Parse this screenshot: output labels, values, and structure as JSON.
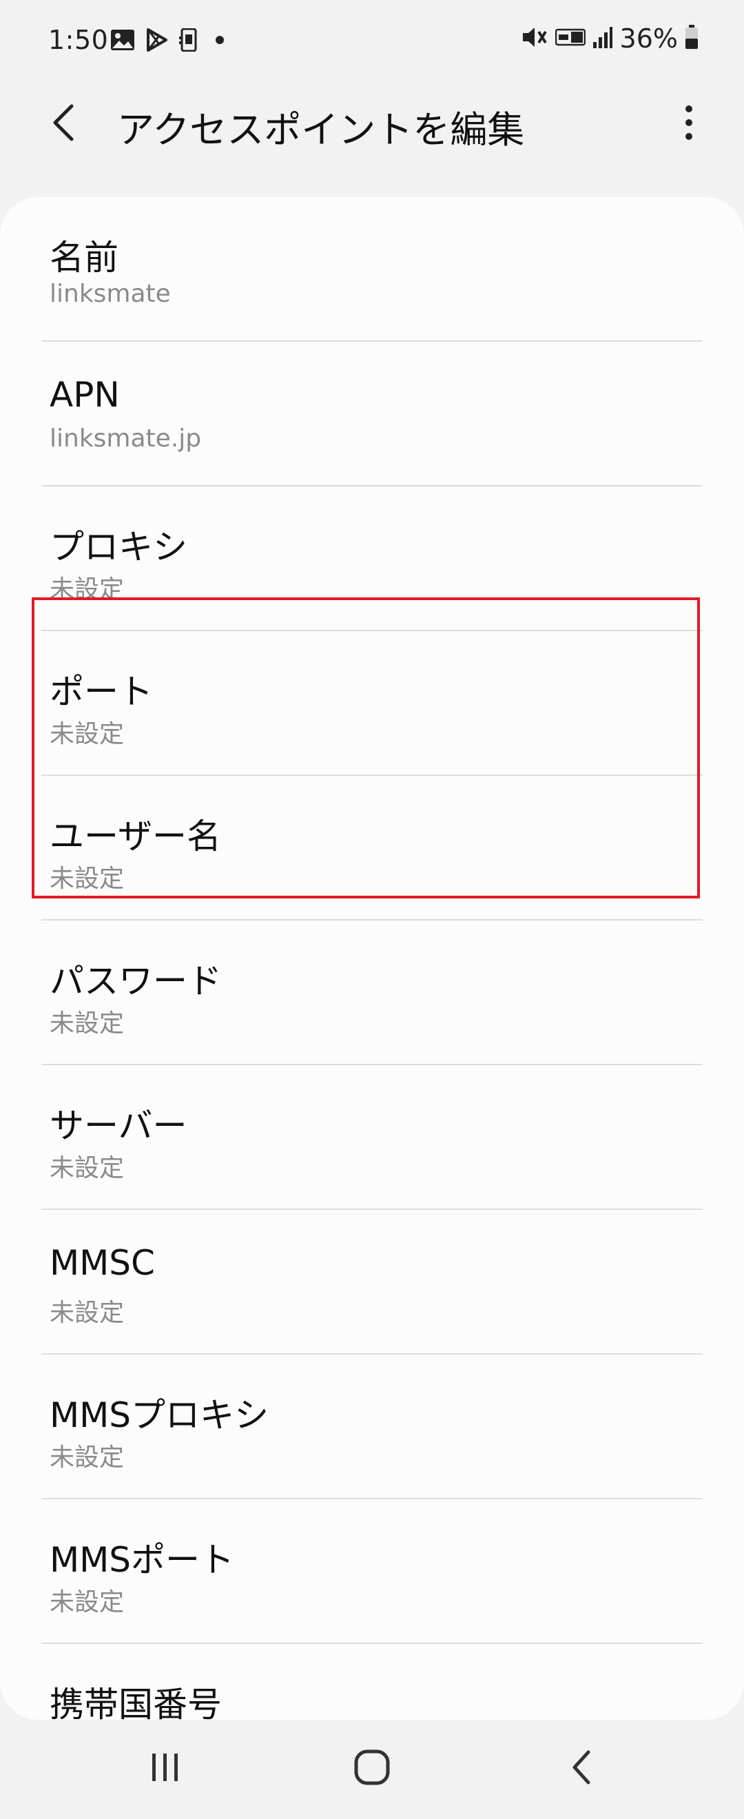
{
  "status_bar": {
    "time": "1:50",
    "battery": "36%",
    "left_icons": [
      "image-icon",
      "play-store-icon",
      "sim-icon",
      "dot-icon"
    ],
    "right_icons": [
      "mute-vibrate-icon",
      "volte-icon",
      "signal-icon",
      "battery-icon"
    ]
  },
  "app_bar": {
    "title": "アクセスポイントを編集",
    "back_icon": "chevron-left-icon",
    "more_icon": "more-vert-icon"
  },
  "settings": [
    {
      "label": "名前",
      "value": "linksmate"
    },
    {
      "label": "APN",
      "value": "linksmate.jp"
    },
    {
      "label": "プロキシ",
      "value": "未設定"
    },
    {
      "label": "ポート",
      "value": "未設定"
    },
    {
      "label": "ユーザー名",
      "value": "未設定"
    },
    {
      "label": "パスワード",
      "value": "未設定"
    },
    {
      "label": "サーバー",
      "value": "未設定"
    },
    {
      "label": "MMSC",
      "value": "未設定"
    },
    {
      "label": "MMSプロキシ",
      "value": "未設定"
    },
    {
      "label": "MMSポート",
      "value": "未設定"
    },
    {
      "label": "携帯国番号",
      "value": ""
    }
  ],
  "highlight": {
    "target": "ユーザー名",
    "color": "#e01b24"
  },
  "nav_bar": {
    "icons": [
      "recent-apps-icon",
      "home-icon",
      "back-icon"
    ]
  }
}
